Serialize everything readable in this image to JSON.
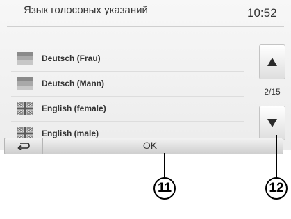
{
  "header": {
    "title": "Язык голосовых указаний",
    "time": "10:52"
  },
  "languages": [
    {
      "label": "Deutsch (Frau)",
      "flag": "flag-de-icon"
    },
    {
      "label": "Deutsch (Mann)",
      "flag": "flag-de-icon"
    },
    {
      "label": "English (female)",
      "flag": "flag-uk-icon"
    },
    {
      "label": "English (male)",
      "flag": "flag-uk-icon"
    }
  ],
  "scroll": {
    "page_indicator": "2/15"
  },
  "footer": {
    "ok_label": "OK"
  },
  "callouts": {
    "ok": "11",
    "scroll": "12"
  }
}
